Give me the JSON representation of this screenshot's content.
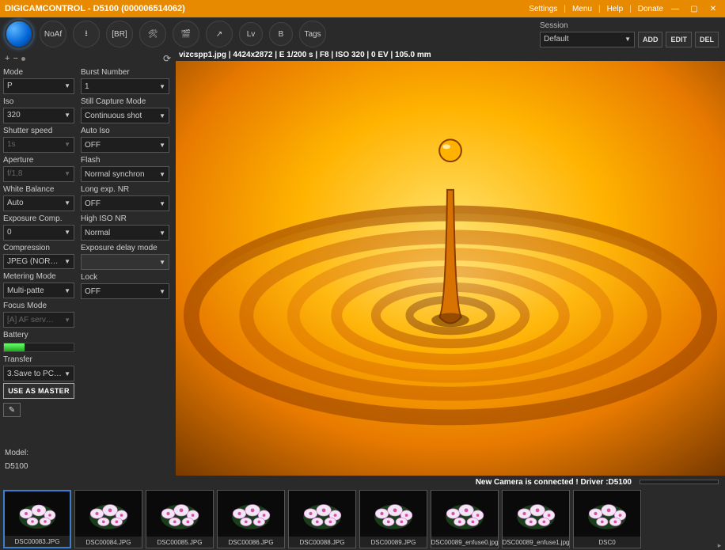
{
  "titlebar": {
    "title": "DIGICAMCONTROL - D5100 (000006514062)",
    "menus": [
      "Settings",
      "Menu",
      "Help",
      "Donate"
    ]
  },
  "toolbar": {
    "noaf": "NoAf",
    "br": "[BR]",
    "lv": "Lv",
    "b": "B",
    "tags": "Tags"
  },
  "session": {
    "label": "Session",
    "value": "Default",
    "add": "ADD",
    "edit": "EDIT",
    "del": "DEL"
  },
  "left_toolstrip": {
    "plus": "+",
    "minus": "−",
    "reload": "⟳"
  },
  "left_panel": [
    {
      "label": "Mode",
      "value": "P"
    },
    {
      "label": "Iso",
      "value": "320"
    },
    {
      "label": "Shutter speed",
      "value": "1s",
      "disabled": true
    },
    {
      "label": "Aperture",
      "value": "f/1,8",
      "disabled": true
    },
    {
      "label": "White Balance",
      "value": "Auto"
    },
    {
      "label": "Exposure Comp.",
      "value": "0"
    },
    {
      "label": "Compression",
      "value": "JPEG (NORM…"
    },
    {
      "label": "Metering Mode",
      "value": "Multi-patte"
    },
    {
      "label": "Focus Mode",
      "value": "[A] AF serv…",
      "disabled": true
    }
  ],
  "battery_label": "Battery",
  "transfer": {
    "label": "Transfer",
    "value": "3.Save to PC …"
  },
  "use_master": "USE AS MASTER",
  "right_panel": [
    {
      "label": "Burst Number",
      "value": "1"
    },
    {
      "label": "Still Capture Mode",
      "value": "Continuous shot"
    },
    {
      "label": "Auto Iso",
      "value": "OFF"
    },
    {
      "label": "Flash",
      "value": "Normal synchron"
    },
    {
      "label": "Long exp. NR",
      "value": "OFF"
    },
    {
      "label": "High ISO NR",
      "value": "Normal"
    },
    {
      "label": "Exposure delay mode",
      "value": "",
      "empty": true
    },
    {
      "label": "Lock",
      "value": "OFF"
    }
  ],
  "model": {
    "label": "Model:",
    "value": "D5100"
  },
  "image_info": "vizcspp1.jpg | 4424x2872 | E 1/200 s | F8 | ISO 320 | 0 EV | 105.0 mm",
  "status": "New Camera is connected ! Driver :D5100",
  "thumbnails": [
    "DSC00083.JPG",
    "DSC00084.JPG",
    "DSC00085.JPG",
    "DSC00086.JPG",
    "DSC00088.JPG",
    "DSC00089.JPG",
    "DSC00089_enfuse0.jpg",
    "DSC00089_enfuse1.jpg",
    "DSC0"
  ]
}
